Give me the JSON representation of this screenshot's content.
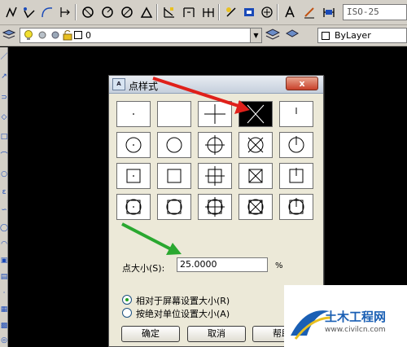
{
  "toolbar": {
    "text_style_value": "ISO-25",
    "icons": [
      "polyline-icon",
      "spline-icon",
      "arc-icon",
      "dimension-icon",
      "circle-icon",
      "rotate-icon",
      "ellipse-icon",
      "angle-icon",
      "ruler-icon",
      "frame-icon",
      "measure-icon",
      "trim-icon",
      "block-icon",
      "center-icon",
      "text-icon",
      "edit-icon",
      "area-icon"
    ]
  },
  "layer_bar": {
    "layer_value": "0",
    "color_value": "ByLayer"
  },
  "dialog": {
    "title": "点样式",
    "close_label": "x",
    "point_size_label": "点大小(S):",
    "point_size_value": "25.0000",
    "percent_label": "%",
    "radio_relative": "相对于屏幕设置大小(R)",
    "radio_absolute": "按绝对单位设置大小(A)",
    "ok_label": "确定",
    "cancel_label": "取消",
    "help_label": "帮助",
    "selected_style_index": 3,
    "styles": [
      "dot",
      "none",
      "plus",
      "x",
      "tick",
      "circle-dot",
      "circle",
      "circle-plus",
      "circle-x",
      "circle-tick",
      "square-dot",
      "square",
      "square-plus",
      "square-x",
      "square-tick",
      "circlesquare-dot",
      "circlesquare",
      "circlesquare-plus",
      "circlesquare-x",
      "circlesquare-tick"
    ]
  },
  "watermark": {
    "brand": "土木工程网",
    "url": "www.civilcn.com"
  },
  "colors": {
    "canvas": "#000000",
    "dialog_bg": "#ece9d8",
    "arrow_red": "#e0201a",
    "arrow_green": "#2aa830",
    "watermark_blue": "#1a5fb4"
  }
}
